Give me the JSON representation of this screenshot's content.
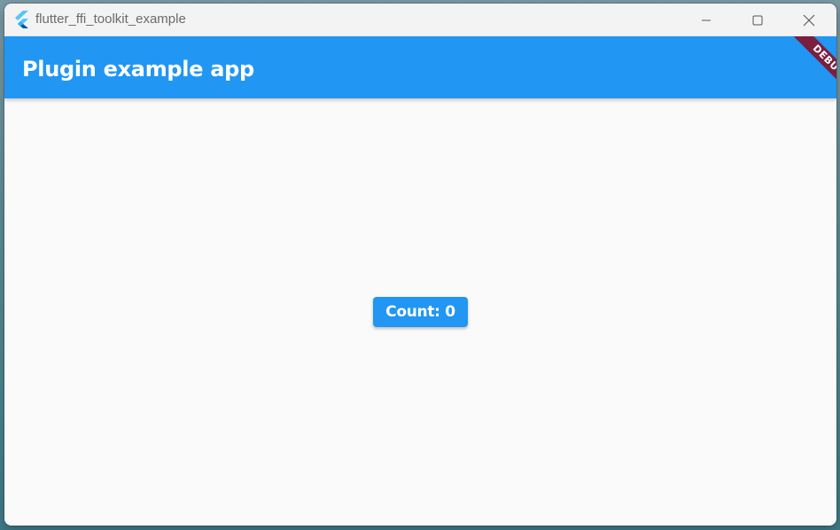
{
  "window": {
    "title": "flutter_ffi_toolkit_example",
    "app_icon": "flutter-logo-icon",
    "controls": {
      "minimize_icon": "minimize-icon",
      "maximize_icon": "maximize-icon",
      "close_icon": "close-icon"
    }
  },
  "appbar": {
    "title": "Plugin example app",
    "background": "#2196f3"
  },
  "debug_banner": {
    "label": "DEBUG",
    "color": "#7a1f3d"
  },
  "main": {
    "count_button_label": "Count: 0",
    "count_button_color": "#2196f3"
  }
}
